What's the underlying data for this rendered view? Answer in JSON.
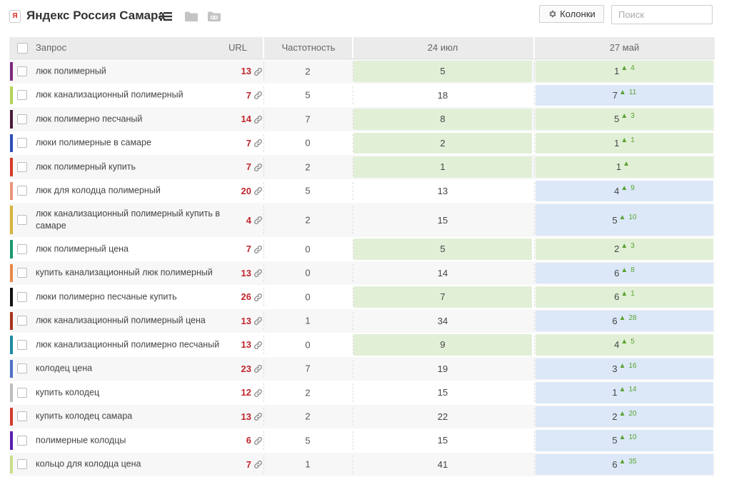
{
  "header": {
    "app_icon": "yandex-icon",
    "app_icon_letter": "Я",
    "title": "Яндекс Россия Самара",
    "columns_button": "Колонки",
    "search_placeholder": "Поиск"
  },
  "table": {
    "columns": {
      "query": "Запрос",
      "url": "URL",
      "frequency": "Частотность",
      "date1": "24 июл",
      "date2": "27 май"
    },
    "rows": [
      {
        "query": "люк полимерный",
        "url_count": "13",
        "frequency": "2",
        "pos1": "5",
        "pos2": "1",
        "delta": "4",
        "color": "#7b2a7e",
        "bg1": "green",
        "bg2": "green"
      },
      {
        "query": "люк канализационный полимерный",
        "url_count": "7",
        "frequency": "5",
        "pos1": "18",
        "pos2": "7",
        "delta": "11",
        "color": "#b5d35a",
        "bg1": "none",
        "bg2": "blue"
      },
      {
        "query": "люк полимерно песчаный",
        "url_count": "14",
        "frequency": "7",
        "pos1": "8",
        "pos2": "5",
        "delta": "3",
        "color": "#4a1c3c",
        "bg1": "green",
        "bg2": "green"
      },
      {
        "query": "люки полимерные в самаре",
        "url_count": "7",
        "frequency": "0",
        "pos1": "2",
        "pos2": "1",
        "delta": "1",
        "color": "#2e4fb8",
        "bg1": "green",
        "bg2": "green"
      },
      {
        "query": "люк полимерный купить",
        "url_count": "7",
        "frequency": "2",
        "pos1": "1",
        "pos2": "1",
        "delta": "",
        "color": "#d53a2a",
        "bg1": "green",
        "bg2": "green"
      },
      {
        "query": "люк для колодца полимерный",
        "url_count": "20",
        "frequency": "5",
        "pos1": "13",
        "pos2": "4",
        "delta": "9",
        "color": "#e9967a",
        "bg1": "none",
        "bg2": "blue"
      },
      {
        "query": "люк канализационный полимерный купить в самаре",
        "url_count": "4",
        "frequency": "2",
        "pos1": "15",
        "pos2": "5",
        "delta": "10",
        "color": "#d4b43c",
        "bg1": "none",
        "bg2": "blue",
        "tall": true
      },
      {
        "query": "люк полимерный цена",
        "url_count": "7",
        "frequency": "0",
        "pos1": "5",
        "pos2": "2",
        "delta": "3",
        "color": "#1a9a6c",
        "bg1": "green",
        "bg2": "green"
      },
      {
        "query": "купить канализационный люк полимерный",
        "url_count": "13",
        "frequency": "0",
        "pos1": "14",
        "pos2": "6",
        "delta": "8",
        "color": "#e8884a",
        "bg1": "none",
        "bg2": "blue"
      },
      {
        "query": "люки полимерно песчаные купить",
        "url_count": "26",
        "frequency": "0",
        "pos1": "7",
        "pos2": "6",
        "delta": "1",
        "color": "#111111",
        "bg1": "green",
        "bg2": "green"
      },
      {
        "query": "люк канализационный полимерный цена",
        "url_count": "13",
        "frequency": "1",
        "pos1": "34",
        "pos2": "6",
        "delta": "28",
        "color": "#a8331e",
        "bg1": "none",
        "bg2": "blue"
      },
      {
        "query": "люк канализационный полимерно песчаный",
        "url_count": "13",
        "frequency": "0",
        "pos1": "9",
        "pos2": "4",
        "delta": "5",
        "color": "#1e8aa0",
        "bg1": "green",
        "bg2": "green"
      },
      {
        "query": "колодец цена",
        "url_count": "23",
        "frequency": "7",
        "pos1": "19",
        "pos2": "3",
        "delta": "16",
        "color": "#4f6fc8",
        "bg1": "none",
        "bg2": "blue"
      },
      {
        "query": "купить колодец",
        "url_count": "12",
        "frequency": "2",
        "pos1": "15",
        "pos2": "1",
        "delta": "14",
        "color": "#bdbdbd",
        "bg1": "none",
        "bg2": "blue"
      },
      {
        "query": "купить колодец самара",
        "url_count": "13",
        "frequency": "2",
        "pos1": "22",
        "pos2": "2",
        "delta": "20",
        "color": "#d13b2e",
        "bg1": "none",
        "bg2": "blue"
      },
      {
        "query": "полимерные колодцы",
        "url_count": "6",
        "frequency": "5",
        "pos1": "15",
        "pos2": "5",
        "delta": "10",
        "color": "#5a1fb0",
        "bg1": "none",
        "bg2": "blue"
      },
      {
        "query": "кольцо для колодца цена",
        "url_count": "7",
        "frequency": "1",
        "pos1": "41",
        "pos2": "6",
        "delta": "35",
        "color": "#c8df8a",
        "bg1": "none",
        "bg2": "blue"
      }
    ]
  },
  "colors": {
    "accent_red": "#c0272d",
    "up_green": "#59a22f",
    "cell_green": "#e2efd7",
    "cell_blue": "#dce8f8"
  },
  "icons": {
    "list": "list-icon",
    "folder": "folder-icon",
    "link_group": "link-folder-icon",
    "gear": "gear-icon",
    "url_link": "link-icon",
    "trend_up": "triangle-up-icon"
  }
}
